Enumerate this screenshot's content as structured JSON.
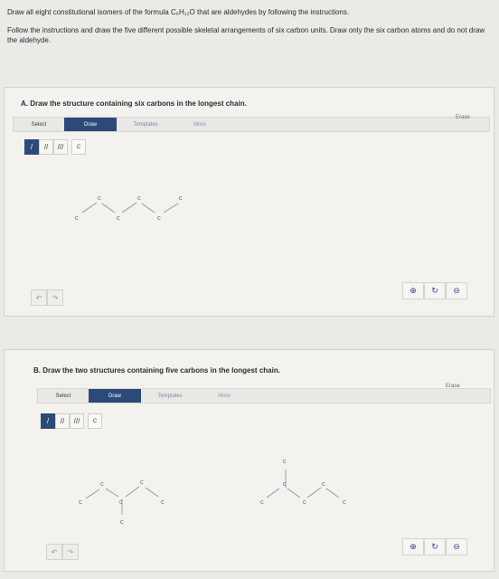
{
  "instructions": {
    "line1": "Draw all eight constitutional isomers of the formula C₆H₁₂O that are aldehydes by following the instructions.",
    "line2": "Follow the instructions and draw the five different possible skeletal arrangements of six carbon units. Draw only the six carbon atoms and do not draw the aldehyde."
  },
  "panelA": {
    "prompt": "A. Draw the structure containing six carbons in the longest chain.",
    "toolbar": {
      "select": "Select",
      "draw": "Draw",
      "templates": "Templates",
      "more": "More"
    },
    "erase": "Erase",
    "bonds": {
      "single": "/",
      "double": "//",
      "triple": "///"
    },
    "atom": "C",
    "atom_label": "C"
  },
  "panelB": {
    "prompt": "B. Draw the two structures containing five carbons in the longest chain.",
    "toolbar": {
      "select": "Select",
      "draw": "Draw",
      "templates": "Templates",
      "more": "More"
    },
    "erase": "Erase",
    "bonds": {
      "single": "/",
      "double": "//",
      "triple": "///"
    },
    "atom": "C",
    "atom_label": "C"
  },
  "icons": {
    "undo": "↶",
    "redo": "↷",
    "zoom_in": "⊕",
    "reset": "↻",
    "zoom_out": "⊖"
  }
}
